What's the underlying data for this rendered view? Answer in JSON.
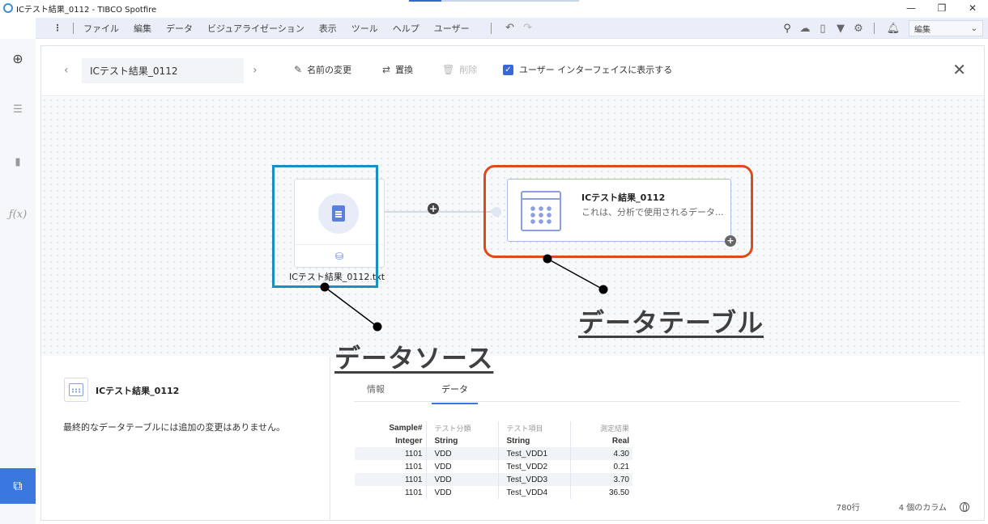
{
  "window": {
    "title": "ICテスト結果_0112 - TIBCO Spotfire",
    "minimize": "—",
    "restore": "❐",
    "close": "✕"
  },
  "menubar": {
    "items": [
      "ファイル",
      "編集",
      "データ",
      "ビジュアライゼーション",
      "表示",
      "ツール",
      "ヘルプ",
      "ユーザー"
    ],
    "edit_select": "編集"
  },
  "toolbar": {
    "name": "ICテスト結果_0112",
    "rename": "名前の変更",
    "replace": "置換",
    "delete": "削除",
    "show_in_ui": "ユーザー インターフェイスに表示する"
  },
  "canvas": {
    "source_label": "ICテスト結果_0112.txt",
    "table_name": "ICテスト結果_0112",
    "table_desc": "これは、分析で使用されるデータ..."
  },
  "annotations": {
    "data_source": "データソース",
    "data_table": "データテーブル",
    "blue_color": "#1a8fc0",
    "red_color": "#e04a1a"
  },
  "details": {
    "name": "ICテスト結果_0112",
    "message": "最終的なデータテーブルには追加の変更はありません。"
  },
  "preview": {
    "tabs": [
      "情報",
      "データ"
    ],
    "columns": [
      "Sample#",
      "テスト分類",
      "テスト項目",
      "測定結果"
    ],
    "types": [
      "Integer",
      "String",
      "String",
      "Real"
    ],
    "rows": [
      [
        "1101",
        "VDD",
        "Test_VDD1",
        "4.30"
      ],
      [
        "1101",
        "VDD",
        "Test_VDD2",
        "0.21"
      ],
      [
        "1101",
        "VDD",
        "Test_VDD3",
        "3.70"
      ],
      [
        "1101",
        "VDD",
        "Test_VDD4",
        "36.50"
      ]
    ],
    "row_count": "780行",
    "column_count": "4 個のカラム"
  }
}
